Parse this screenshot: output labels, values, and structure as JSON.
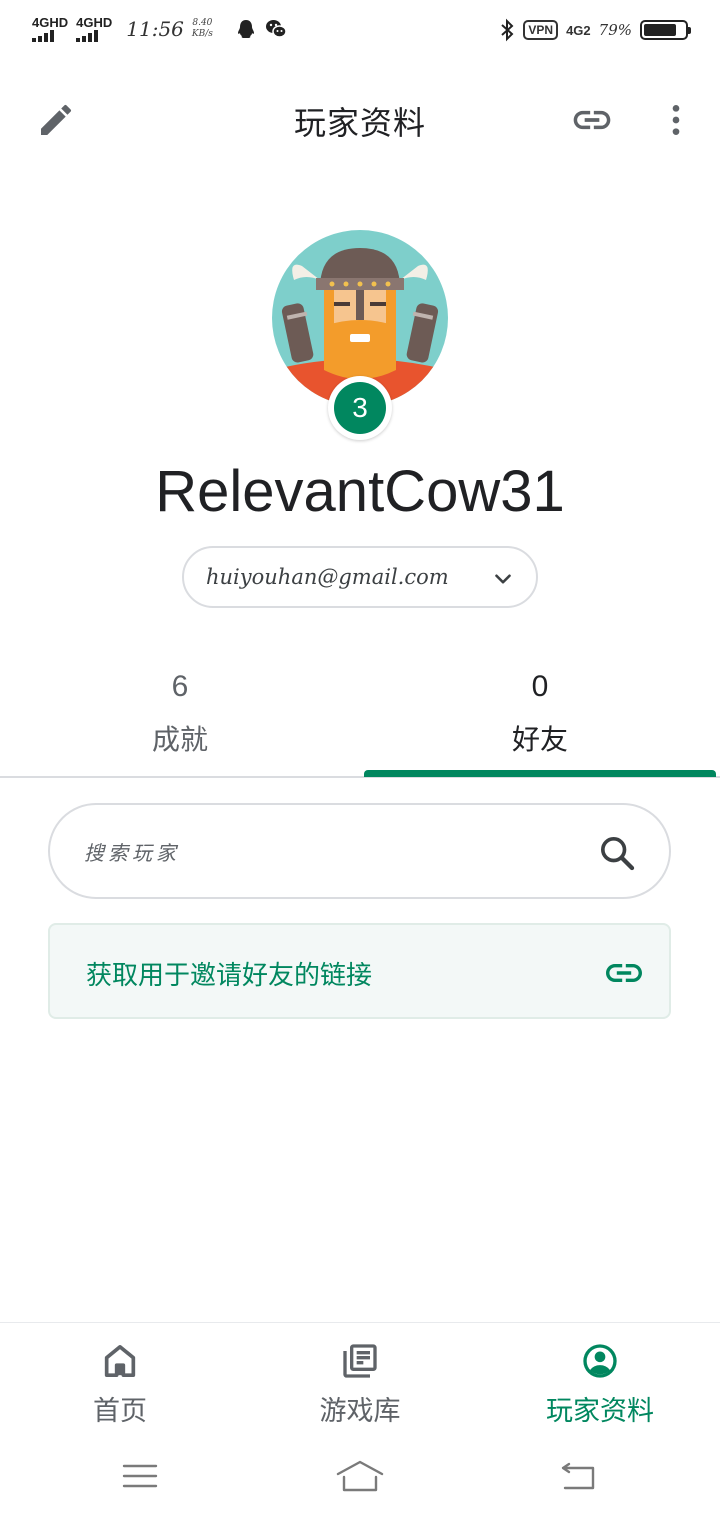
{
  "status_bar": {
    "sim1": "4GHD",
    "sim2": "4GHD",
    "time": "11:56",
    "speed_value": "8.40",
    "speed_unit": "KB/s",
    "vpn": "VPN",
    "network": "4G2",
    "battery": "79%",
    "battery_level": 0.79,
    "icons": [
      "qq-icon",
      "wechat-icon",
      "bluetooth-icon"
    ]
  },
  "app_bar": {
    "title": "玩家资料",
    "icons": [
      "edit-icon",
      "link-icon",
      "more-vert-icon"
    ]
  },
  "profile": {
    "level": "3",
    "username": "RelevantCow31",
    "account_email": "huiyouhan@gmail.com"
  },
  "tabs": [
    {
      "count": "6",
      "label": "成就",
      "selected": false
    },
    {
      "count": "0",
      "label": "好友",
      "selected": true
    }
  ],
  "search": {
    "placeholder": "搜索玩家"
  },
  "invite": {
    "label": "获取用于邀请好友的链接"
  },
  "bottom_nav": [
    {
      "label": "首页",
      "icon": "home-icon",
      "selected": false
    },
    {
      "label": "游戏库",
      "icon": "library-icon",
      "selected": false
    },
    {
      "label": "玩家资料",
      "icon": "account-circle-icon",
      "selected": true
    }
  ],
  "colors": {
    "accent": "#01875f",
    "text_primary": "#202124",
    "text_secondary": "#5f6368",
    "divider": "#dadce0"
  }
}
